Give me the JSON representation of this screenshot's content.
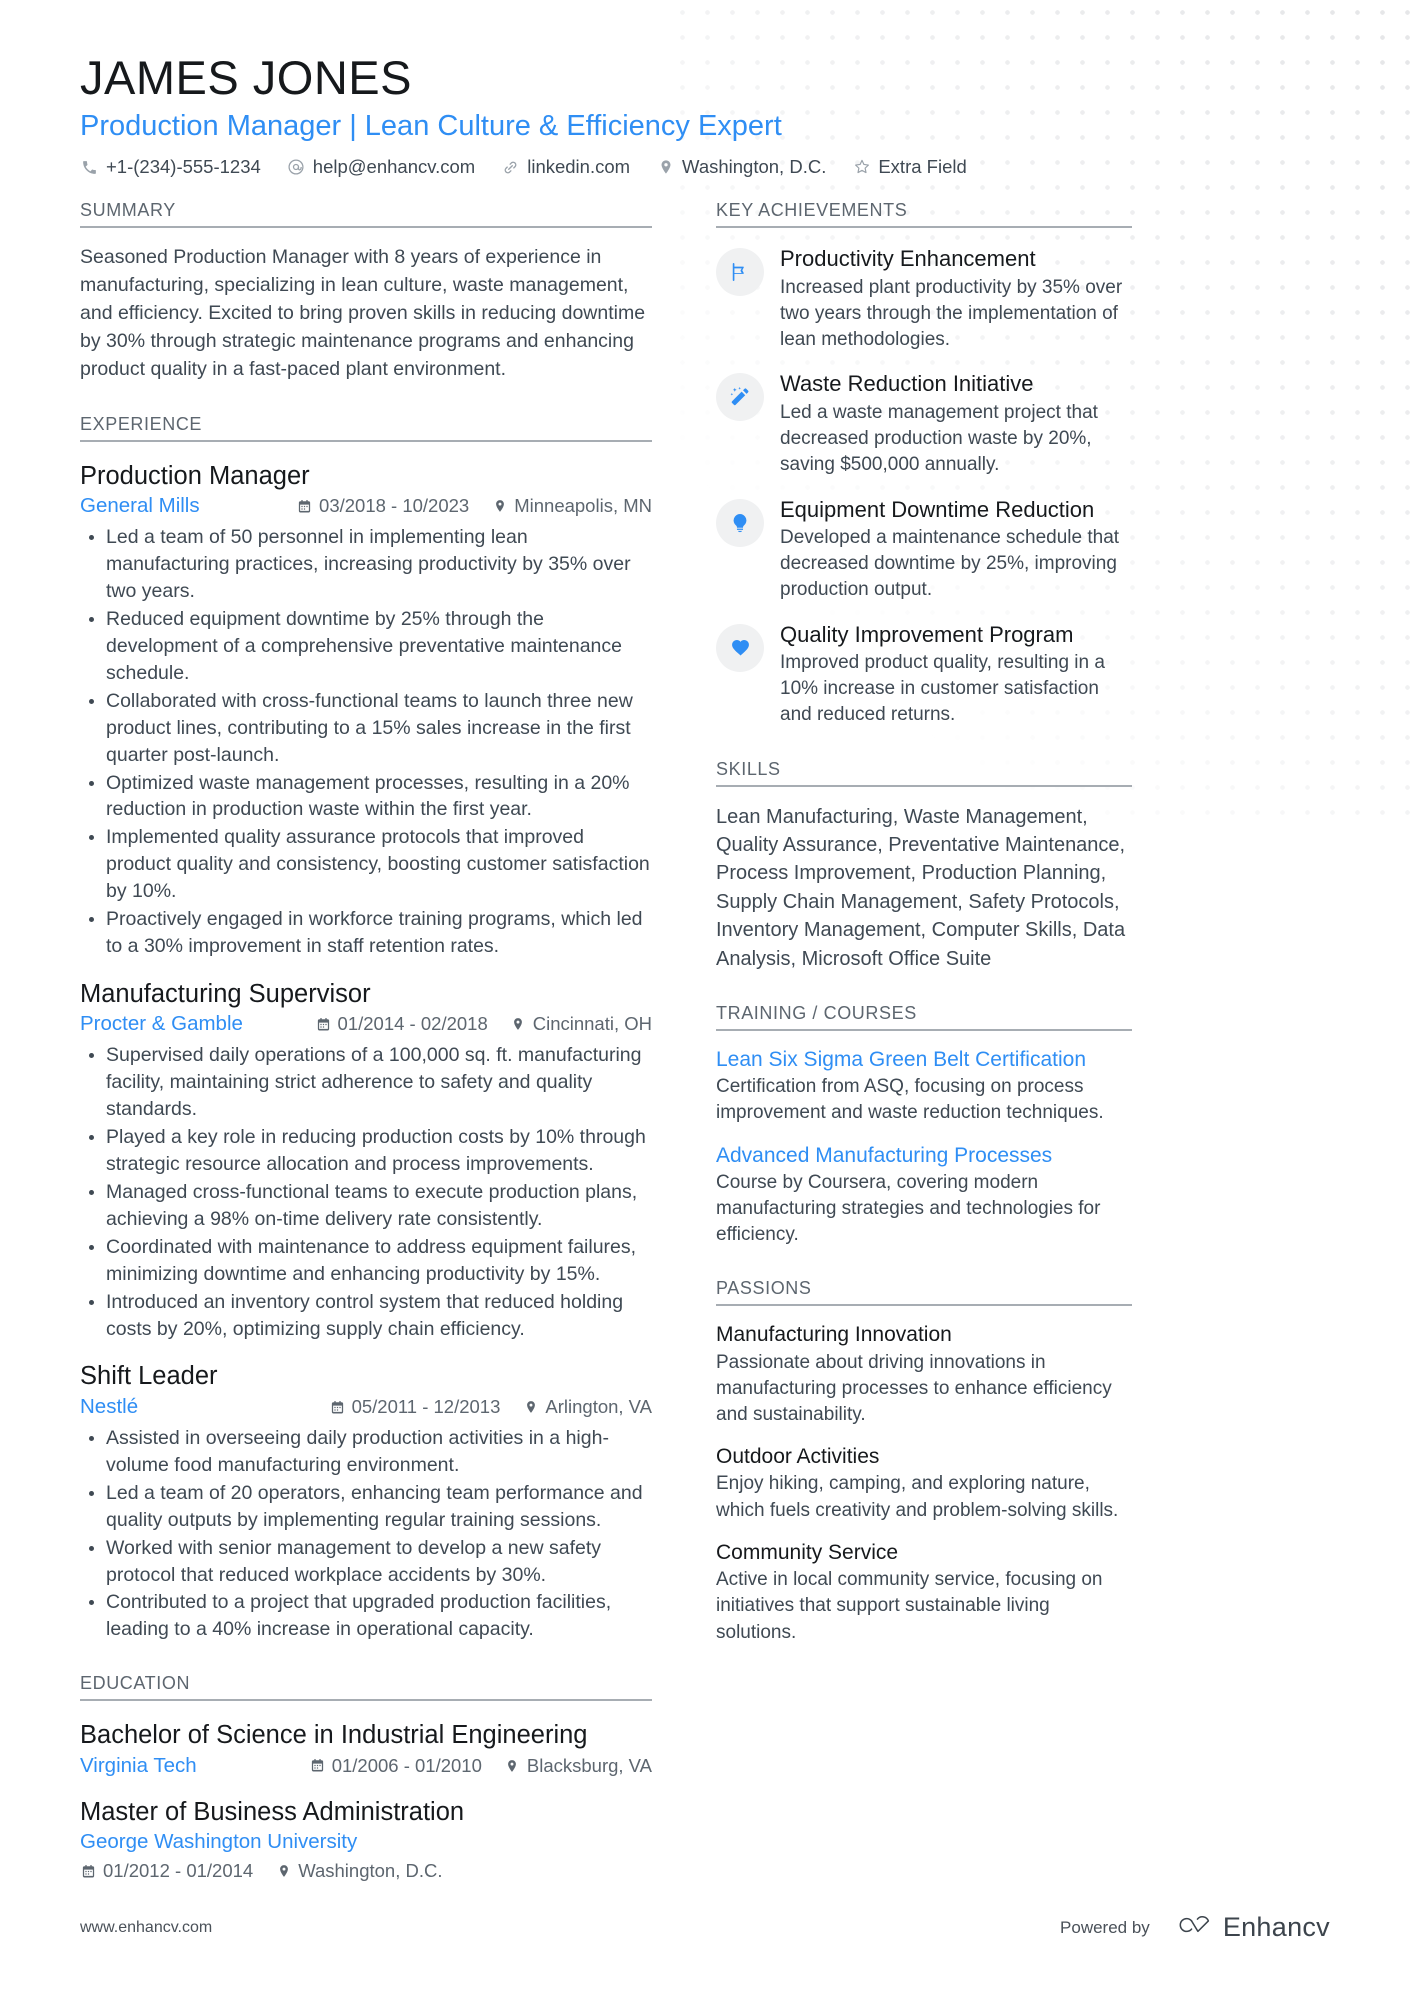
{
  "header": {
    "name": "JAMES JONES",
    "headline": "Production Manager | Lean Culture & Efficiency Expert",
    "contacts": [
      {
        "icon": "phone-icon",
        "text": "+1-(234)-555-1234"
      },
      {
        "icon": "email-icon",
        "text": "help@enhancv.com"
      },
      {
        "icon": "link-icon",
        "text": "linkedin.com"
      },
      {
        "icon": "location-icon",
        "text": "Washington, D.C."
      },
      {
        "icon": "star-icon",
        "text": "Extra Field"
      }
    ]
  },
  "summary": {
    "heading": "SUMMARY",
    "text": "Seasoned Production Manager with 8 years of experience in manufacturing, specializing in lean culture, waste management, and efficiency. Excited to bring proven skills in reducing downtime by 30% through strategic maintenance programs and enhancing product quality in a fast-paced plant environment."
  },
  "experience": {
    "heading": "EXPERIENCE",
    "entries": [
      {
        "title": "Production Manager",
        "org": "General Mills",
        "dates": "03/2018 - 10/2023",
        "location": "Minneapolis, MN",
        "bullets": [
          "Led a team of 50 personnel in implementing lean manufacturing practices, increasing productivity by 35% over two years.",
          "Reduced equipment downtime by 25% through the development of a comprehensive preventative maintenance schedule.",
          "Collaborated with cross-functional teams to launch three new product lines, contributing to a 15% sales increase in the first quarter post-launch.",
          "Optimized waste management processes, resulting in a 20% reduction in production waste within the first year.",
          "Implemented quality assurance protocols that improved product quality and consistency, boosting customer satisfaction by 10%.",
          "Proactively engaged in workforce training programs, which led to a 30% improvement in staff retention rates."
        ]
      },
      {
        "title": "Manufacturing Supervisor",
        "org": "Procter & Gamble",
        "dates": "01/2014 - 02/2018",
        "location": "Cincinnati, OH",
        "bullets": [
          "Supervised daily operations of a 100,000 sq. ft. manufacturing facility, maintaining strict adherence to safety and quality standards.",
          "Played a key role in reducing production costs by 10% through strategic resource allocation and process improvements.",
          "Managed cross-functional teams to execute production plans, achieving a 98% on-time delivery rate consistently.",
          "Coordinated with maintenance to address equipment failures, minimizing downtime and enhancing productivity by 15%.",
          "Introduced an inventory control system that reduced holding costs by 20%, optimizing supply chain efficiency."
        ]
      },
      {
        "title": "Shift Leader",
        "org": "Nestlé",
        "dates": "05/2011 - 12/2013",
        "location": "Arlington, VA",
        "bullets": [
          "Assisted in overseeing daily production activities in a high-volume food manufacturing environment.",
          "Led a team of 20 operators, enhancing team performance and quality outputs by implementing regular training sessions.",
          "Worked with senior management to develop a new safety protocol that reduced workplace accidents by 30%.",
          "Contributed to a project that upgraded production facilities, leading to a 40% increase in operational capacity."
        ]
      }
    ]
  },
  "education": {
    "heading": "EDUCATION",
    "entries": [
      {
        "title": "Bachelor of Science in Industrial Engineering",
        "org": "Virginia Tech",
        "dates": "01/2006 - 01/2010",
        "location": "Blacksburg, VA",
        "meta_below": false
      },
      {
        "title": "Master of Business Administration",
        "org": "George Washington University",
        "dates": "01/2012 - 01/2014",
        "location": "Washington, D.C.",
        "meta_below": true
      }
    ]
  },
  "key_achievements": {
    "heading": "KEY ACHIEVEMENTS",
    "items": [
      {
        "icon": "flag-icon",
        "title": "Productivity Enhancement",
        "desc": "Increased plant productivity by 35% over two years through the implementation of lean methodologies."
      },
      {
        "icon": "magic-wand-icon",
        "title": "Waste Reduction Initiative",
        "desc": "Led a waste management project that decreased production waste by 20%, saving $500,000 annually."
      },
      {
        "icon": "lightbulb-icon",
        "title": "Equipment Downtime Reduction",
        "desc": "Developed a maintenance schedule that decreased downtime by 25%, improving production output."
      },
      {
        "icon": "heart-icon",
        "title": "Quality Improvement Program",
        "desc": "Improved product quality, resulting in a 10% increase in customer satisfaction and reduced returns."
      }
    ]
  },
  "skills": {
    "heading": "SKILLS",
    "text": "Lean Manufacturing, Waste Management, Quality Assurance, Preventative Maintenance, Process Improvement, Production Planning, Supply Chain Management, Safety Protocols, Inventory Management, Computer Skills, Data Analysis, Microsoft Office Suite"
  },
  "training": {
    "heading": "TRAINING / COURSES",
    "entries": [
      {
        "title": "Lean Six Sigma Green Belt Certification",
        "desc": "Certification from ASQ, focusing on process improvement and waste reduction techniques."
      },
      {
        "title": "Advanced Manufacturing Processes",
        "desc": "Course by Coursera, covering modern manufacturing strategies and technologies for efficiency."
      }
    ]
  },
  "passions": {
    "heading": "PASSIONS",
    "entries": [
      {
        "title": "Manufacturing Innovation",
        "desc": "Passionate about driving innovations in manufacturing processes to enhance efficiency and sustainability."
      },
      {
        "title": "Outdoor Activities",
        "desc": "Enjoy hiking, camping, and exploring nature, which fuels creativity and problem-solving skills."
      },
      {
        "title": "Community Service",
        "desc": "Active in local community service, focusing on initiatives that support sustainable living solutions."
      }
    ]
  },
  "footer": {
    "url": "www.enhancv.com",
    "powered_by": "Powered by",
    "brand": "Enhancv"
  },
  "colors": {
    "accent": "#2f8ef4",
    "text": "#3f4953",
    "heading": "#16191c",
    "muted": "#5d666f"
  }
}
